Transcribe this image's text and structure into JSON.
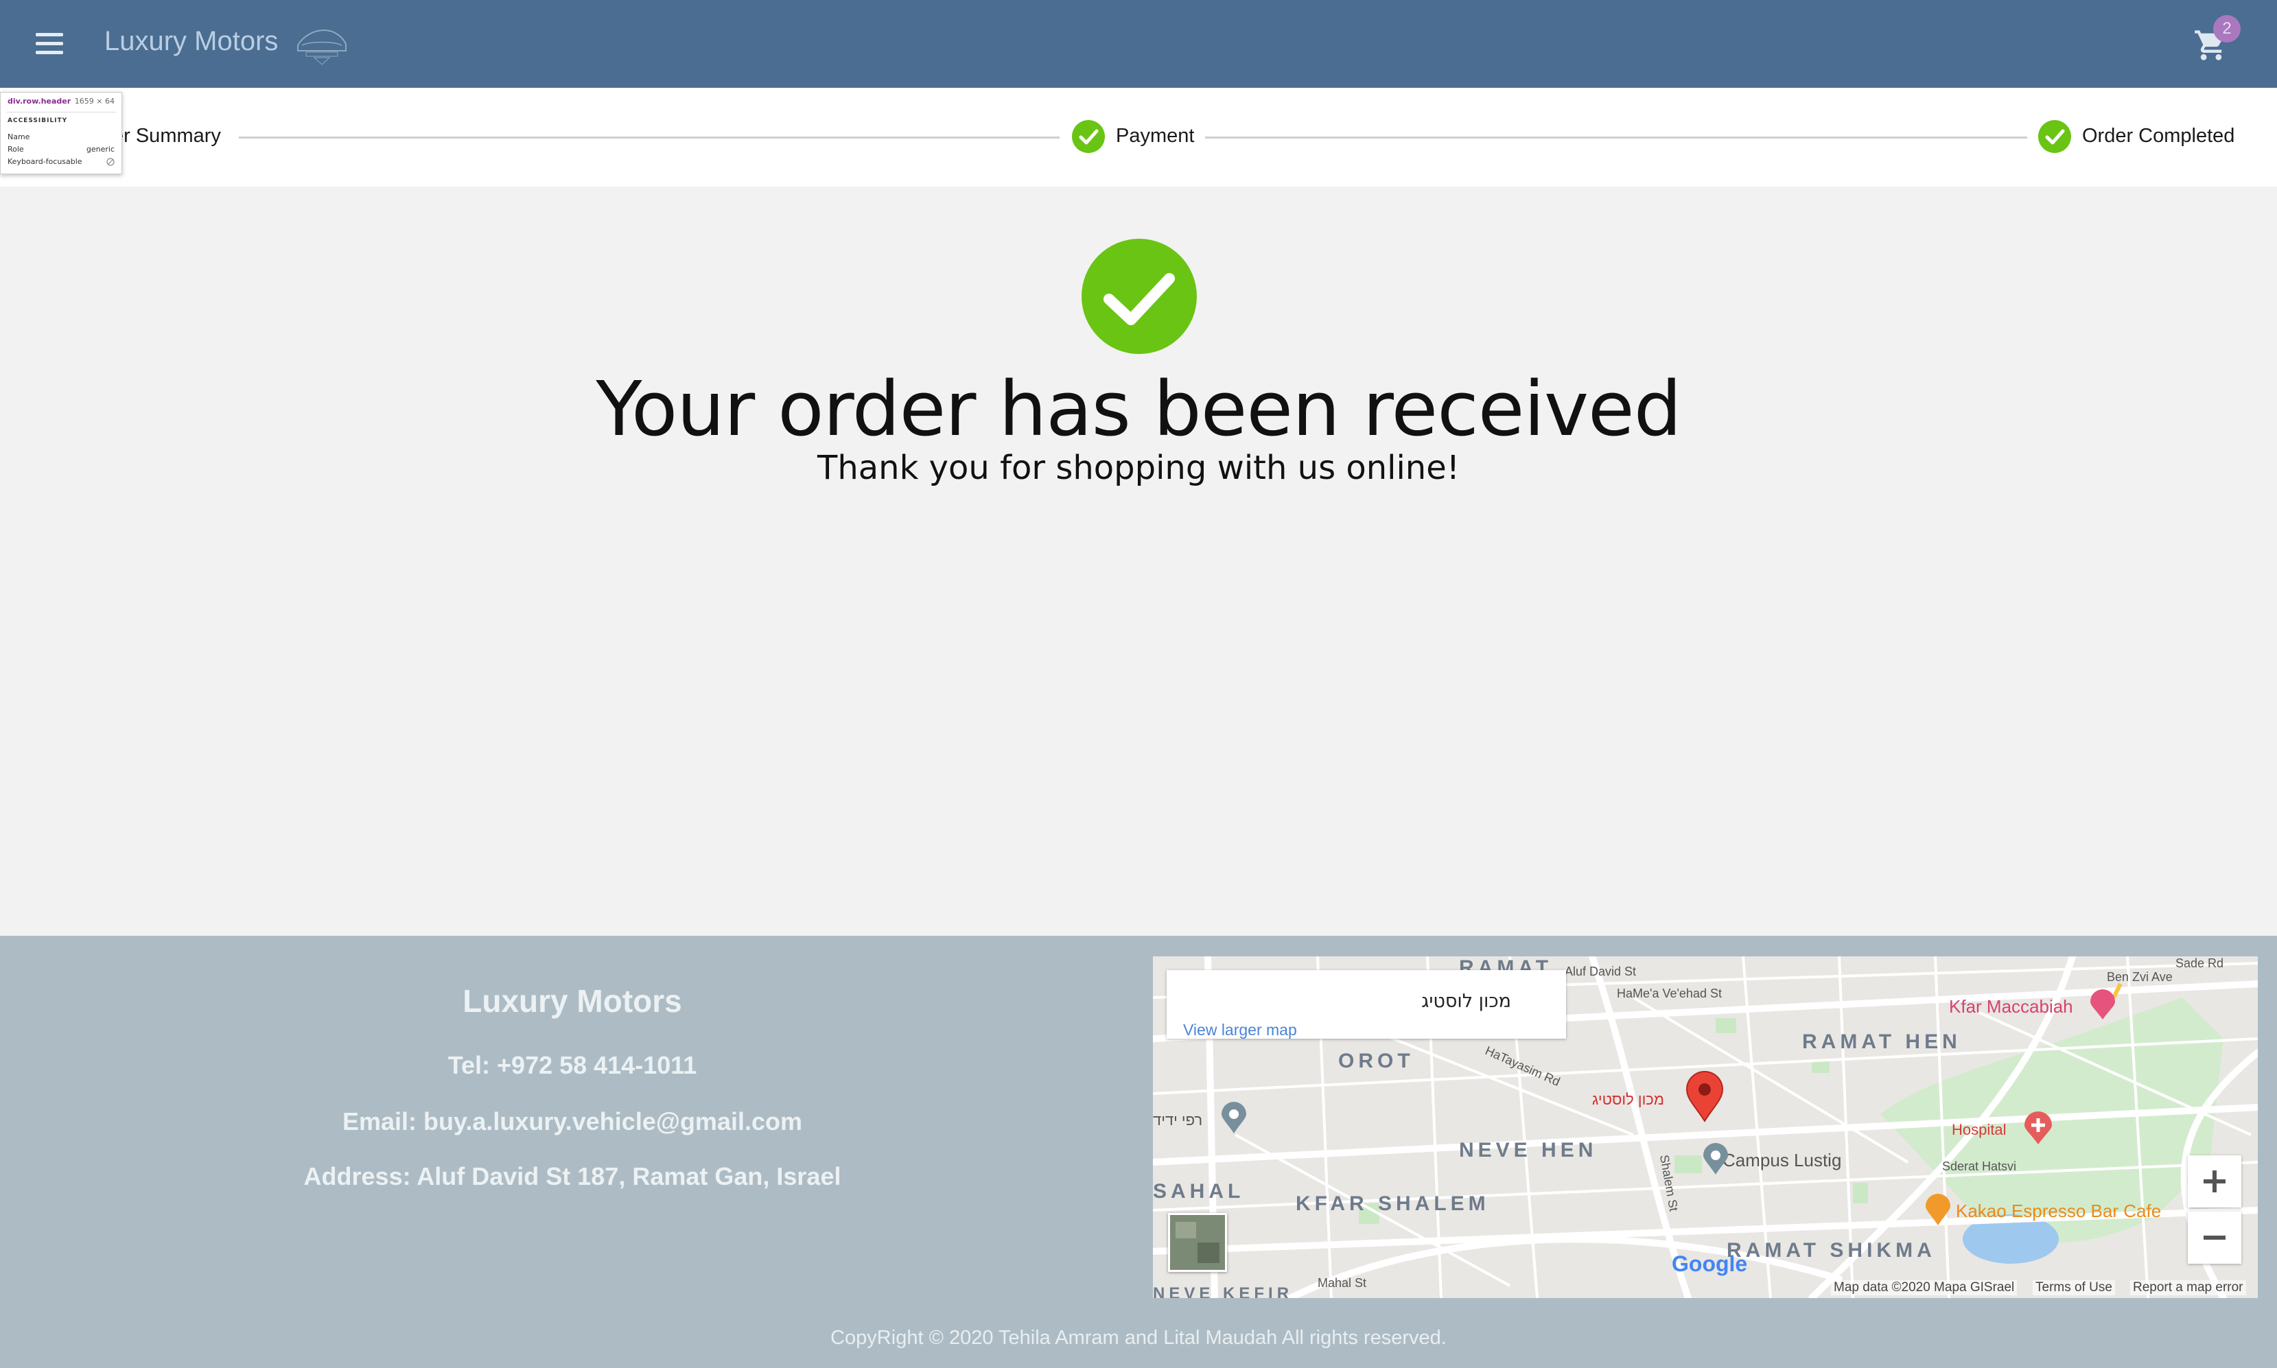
{
  "header": {
    "brand": "Luxury Motors",
    "menu_icon": "hamburger-menu-icon",
    "logo_icon": "car-logo-icon",
    "cart_icon": "shopping-cart-icon",
    "cart_count": "2",
    "colors": {
      "bar": "#4a6d91",
      "brand_text": "#b9cde3",
      "badge": "#a978bf"
    }
  },
  "devtools_tooltip": {
    "selector": "div.row.header",
    "size": "1659 × 64",
    "section": "ACCESSIBILITY",
    "name_label": "Name",
    "name_value": "",
    "role_label": "Role",
    "role_value": "generic",
    "focus_label": "Keyboard-focusable",
    "focus_icon": "not-allowed-icon"
  },
  "stepper": {
    "steps": [
      {
        "label": "er Summary"
      },
      {
        "label": "Payment",
        "icon": "check-circle-icon"
      },
      {
        "label": "Order Completed",
        "icon": "check-circle-icon"
      }
    ],
    "check_color": "#6ac414"
  },
  "confirmation": {
    "icon": "check-circle-icon",
    "title": "Your order has been received",
    "subtitle": "Thank you for shopping with us online!"
  },
  "footer": {
    "company": "Luxury Motors",
    "tel": "Tel: +972 58 414-1011",
    "email": "Email: buy.a.luxury.vehicle@gmail.com",
    "address": "Address: Aluf David St 187, Ramat Gan, Israel",
    "copyright": "CopyRight © 2020 Tehila Amram and Lital Maudah All rights reserved."
  },
  "map": {
    "place_name": "מכון לוסטיג",
    "view_larger": "View larger map",
    "pin_label": "מכון לוסטיג",
    "areas": {
      "ramat_top": "RAMAT",
      "orot": "OROT",
      "neve_hen": "NEVE HEN",
      "kfar_shalem": "KFAR SHALEM",
      "ramat_hen": "RAMAT HEN",
      "ramat_shikma": "RAMAT SHIKMA",
      "sahal": "SAHAL",
      "neve_kefir": "NEVE KEFIR"
    },
    "pois": {
      "kfar_maccabiah": "Kfar Maccabiah",
      "hospital": "Hospital",
      "campus": "Campus Lustig",
      "cafe": "Kakao Espresso Bar Cafe",
      "rafi": "רפי ידיד"
    },
    "streets": [
      "Aluf David St",
      "HaMe'a Ve'ehad St",
      "HaTayasim Rd",
      "Mahal St",
      "Ben Zvi Ave",
      "Sade Rd",
      "Shalem St",
      "Sderat Hatsvi"
    ],
    "zoom_in_icon": "plus-icon",
    "zoom_out_icon": "minus-icon",
    "satellite_toggle_icon": "satellite-thumbnail-icon",
    "google_logo": "Google",
    "attribution": "Map data ©2020 Mapa GISrael",
    "terms": "Terms of Use",
    "report": "Report a map error"
  }
}
